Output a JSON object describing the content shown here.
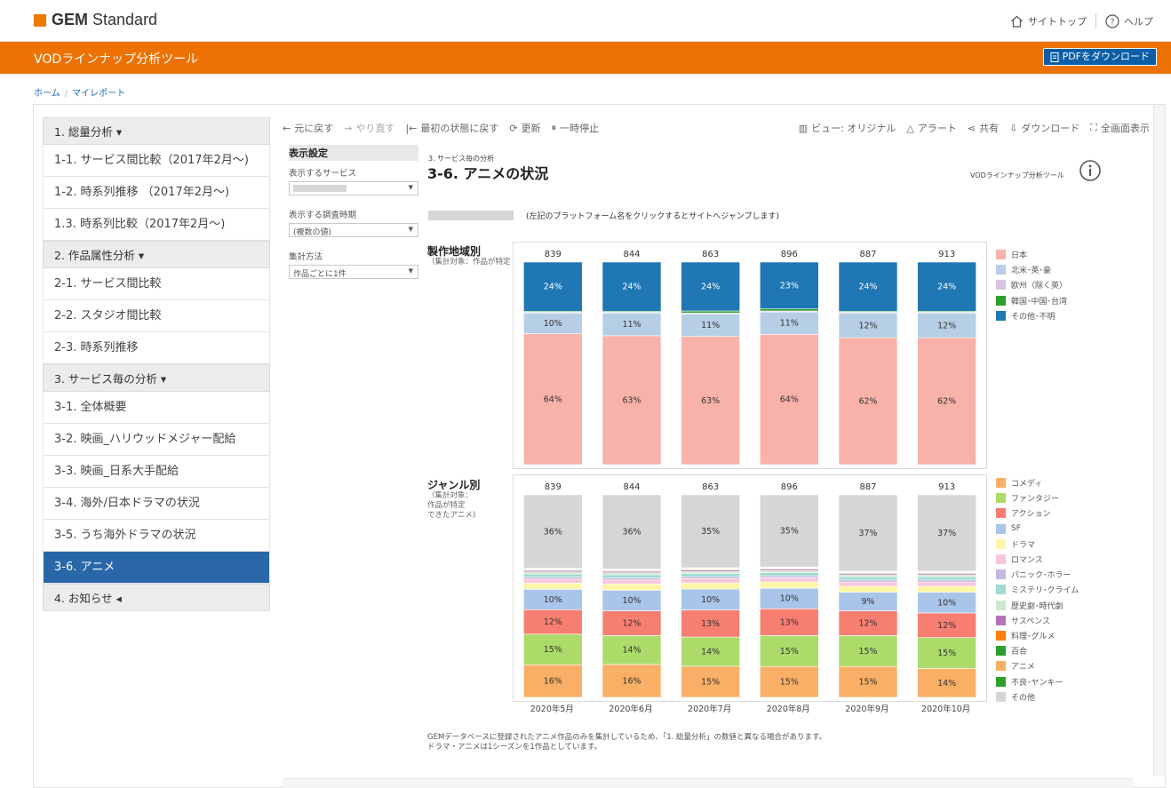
{
  "header": {
    "logo_bold": "GEM",
    "logo_rest": " Standard",
    "site_top": "サイトトップ",
    "help": "ヘルプ"
  },
  "appbar": {
    "title": "VODラインナップ分析ツール",
    "pdf_button": "PDFをダウンロード"
  },
  "breadcrumb": [
    "ホーム",
    "マイレポート"
  ],
  "sidebar": {
    "items": [
      {
        "label": "1. 総量分析 ▾",
        "kind": "head"
      },
      {
        "label": "1-1. サービス間比較（2017年2月～)",
        "kind": "item"
      },
      {
        "label": "1-2. 時系列推移 （2017年2月～)",
        "kind": "item"
      },
      {
        "label": "1.3. 時系列比較（2017年2月～)",
        "kind": "item"
      },
      {
        "label": "2. 作品属性分析 ▾",
        "kind": "head"
      },
      {
        "label": "2-1. サービス間比較",
        "kind": "item"
      },
      {
        "label": "2-2. スタジオ間比較",
        "kind": "item"
      },
      {
        "label": "2-3. 時系列推移",
        "kind": "item"
      },
      {
        "label": "3. サービス毎の分析 ▾",
        "kind": "head"
      },
      {
        "label": "3-1. 全体概要",
        "kind": "item"
      },
      {
        "label": "3-2. 映画_ハリウッドメジャー配給",
        "kind": "item"
      },
      {
        "label": "3-3. 映画_日系大手配給",
        "kind": "item"
      },
      {
        "label": "3-4. 海外/日本ドラマの状況",
        "kind": "item"
      },
      {
        "label": "3-5. うち海外ドラマの状況",
        "kind": "item"
      },
      {
        "label": "3-6. アニメ",
        "kind": "active"
      },
      {
        "label": "4. お知らせ ◂",
        "kind": "head"
      }
    ]
  },
  "toolbar": {
    "undo": "元に戻す",
    "redo": "やり直す",
    "revert": "最初の状態に戻す",
    "refresh": "更新",
    "pause": "一時停止",
    "view": "ビュー: オリジナル",
    "alert": "アラート",
    "share": "共有",
    "download": "ダウンロード",
    "fullscreen": "全画面表示"
  },
  "settings": {
    "title": "表示設定",
    "service_label": "表示するサービス",
    "period_label": "表示する調査時期",
    "period_value": "(複数の値)",
    "method_label": "集計方法",
    "method_value": "作品ごとに1件"
  },
  "dashboard": {
    "subtitle": "3. サービス毎の分析",
    "title": "3-6. アニメの状況",
    "tool_name": "VODラインナップ分析ツール",
    "platform_note": "(左記のプラットフォーム名をクリックするとサイトへジャンプします)",
    "footnote_1": "GEMデータベースに登録されたアニメ作品のみを集計しているため、「1. 総量分析」の数値と異なる場合があります。",
    "footnote_2": "ドラマ・アニメは1シーズンを1作品としています。"
  },
  "colors": {
    "accent_orange": "#ee7203",
    "nav_active": "#2967a8",
    "pdf_button": "#0b5ea8"
  },
  "chart_data": [
    {
      "type": "bar",
      "stacked": true,
      "title": "製作地域別",
      "note": "（集計対象：作品が特定",
      "categories": [
        "2020年5月",
        "2020年6月",
        "2020年7月",
        "2020年8月",
        "2020年9月",
        "2020年10月"
      ],
      "totals": [
        839,
        844,
        863,
        896,
        887,
        913
      ],
      "ylim": [
        0,
        100
      ],
      "series": [
        {
          "name": "日本",
          "color": "#f9b2aa",
          "values": [
            64,
            63,
            63,
            64,
            62,
            62
          ],
          "labels": [
            "64%",
            "63%",
            "63%",
            "64%",
            "62%",
            "62%"
          ]
        },
        {
          "name": "北米･英･豪",
          "color": "#b7cfe6",
          "values": [
            10,
            11,
            11,
            11,
            12,
            12
          ],
          "labels": [
            "10%",
            "11%",
            "11%",
            "11%",
            "12%",
            "12%"
          ]
        },
        {
          "name": "欧州（除く英）",
          "color": "#d9c4e0",
          "values": [
            0.5,
            0.5,
            0.5,
            0.5,
            0.5,
            0.5
          ],
          "labels": [
            "",
            "",
            "",
            "",
            "",
            ""
          ]
        },
        {
          "name": "韓国･中国･台湾",
          "color": "#2ca02c",
          "values": [
            0.5,
            0.5,
            1,
            1,
            0.5,
            0.5
          ],
          "labels": [
            "",
            "",
            "",
            "",
            "",
            ""
          ]
        },
        {
          "name": "その他･不明",
          "color": "#1f77b4",
          "values": [
            24,
            24,
            24,
            23,
            24,
            24
          ],
          "labels": [
            "24%",
            "24%",
            "24%",
            "23%",
            "24%",
            "24%"
          ]
        }
      ]
    },
    {
      "type": "bar",
      "stacked": true,
      "title": "ジャンル別",
      "note_1": "（集計対象：",
      "note_2": "作品が特定",
      "note_3": "できたアニメ)",
      "categories": [
        "2020年5月",
        "2020年6月",
        "2020年7月",
        "2020年8月",
        "2020年9月",
        "2020年10月"
      ],
      "totals": [
        839,
        844,
        863,
        896,
        887,
        913
      ],
      "ylim": [
        0,
        100
      ],
      "series": [
        {
          "name": "コメディ",
          "color": "#f9b066",
          "values": [
            16,
            16,
            15,
            15,
            15,
            14
          ],
          "labels": [
            "16%",
            "16%",
            "15%",
            "15%",
            "15%",
            "14%"
          ]
        },
        {
          "name": "ファンタジー",
          "color": "#acdb6a",
          "values": [
            15,
            14,
            14,
            15,
            15,
            15
          ],
          "labels": [
            "15%",
            "14%",
            "14%",
            "15%",
            "15%",
            "15%"
          ]
        },
        {
          "name": "アクション",
          "color": "#f77f72",
          "values": [
            12,
            12,
            13,
            13,
            12,
            12
          ],
          "labels": [
            "12%",
            "12%",
            "13%",
            "13%",
            "12%",
            "12%"
          ]
        },
        {
          "name": "SF",
          "color": "#a9c5ea",
          "values": [
            10,
            10,
            10,
            10,
            9,
            10
          ],
          "labels": [
            "10%",
            "10%",
            "10%",
            "10%",
            "9%",
            "10%"
          ]
        },
        {
          "name": "ドラマ",
          "color": "#fef6a8",
          "values": [
            3,
            3,
            3,
            3,
            3,
            3
          ],
          "labels": [
            "",
            "",
            "",
            "",
            "",
            ""
          ]
        },
        {
          "name": "ロマンス",
          "color": "#f8c6dc",
          "values": [
            2,
            2,
            2,
            2,
            2,
            2
          ],
          "labels": [
            "",
            "",
            "",
            "",
            "",
            ""
          ]
        },
        {
          "name": "パニック･ホラー",
          "color": "#c5b8de",
          "values": [
            1,
            1,
            1,
            1,
            1,
            1
          ],
          "labels": [
            "",
            "",
            "",
            "",
            "",
            ""
          ]
        },
        {
          "name": "ミステリ･クライム",
          "color": "#9fdad3",
          "values": [
            1.5,
            1.5,
            1.5,
            1.5,
            1.5,
            1.5
          ],
          "labels": [
            "",
            "",
            "",
            "",
            "",
            ""
          ]
        },
        {
          "name": "歴史劇･時代劇",
          "color": "#cfe9cc",
          "values": [
            1,
            1,
            1,
            1,
            1,
            1
          ],
          "labels": [
            "",
            "",
            "",
            "",
            "",
            ""
          ]
        },
        {
          "name": "サスペンス",
          "color": "#b373b9",
          "values": [
            0.7,
            0.7,
            0.7,
            0.7,
            0.7,
            0.7
          ],
          "labels": [
            "",
            "",
            "",
            "",
            "",
            ""
          ]
        },
        {
          "name": "料理･グルメ",
          "color": "#ff7f0e",
          "values": [
            0.3,
            0.3,
            0.3,
            0.3,
            0.3,
            0.3
          ],
          "labels": [
            "",
            "",
            "",
            "",
            "",
            ""
          ]
        },
        {
          "name": "百合",
          "color": "#2ca02c",
          "values": [
            0.3,
            0.3,
            0.3,
            0.3,
            0.3,
            0.3
          ],
          "labels": [
            "",
            "",
            "",
            "",
            "",
            ""
          ]
        },
        {
          "name": "アニメ",
          "color": "#f9b066",
          "values": [
            0.3,
            0.3,
            0.3,
            0.3,
            0.3,
            0.3
          ],
          "labels": [
            "",
            "",
            "",
            "",
            "",
            ""
          ]
        },
        {
          "name": "不良･ヤンキー",
          "color": "#2ca02c",
          "values": [
            0.2,
            0.2,
            0.2,
            0.2,
            0.2,
            0.2
          ],
          "labels": [
            "",
            "",
            "",
            "",
            "",
            ""
          ]
        },
        {
          "name": "その他",
          "color": "#d6d6d6",
          "values": [
            36,
            36,
            35,
            35,
            37,
            37
          ],
          "labels": [
            "36%",
            "36%",
            "35%",
            "35%",
            "37%",
            "37%"
          ]
        }
      ]
    }
  ]
}
